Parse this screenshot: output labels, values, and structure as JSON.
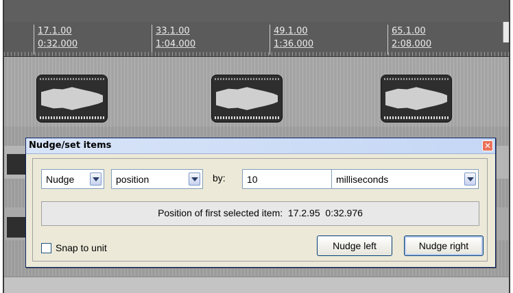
{
  "ruler": {
    "marks": [
      {
        "measure": "17.1.00",
        "time": "0:32.000"
      },
      {
        "measure": "33.1.00",
        "time": "1:04.000"
      },
      {
        "measure": "49.1.00",
        "time": "1:36.000"
      },
      {
        "measure": "65.1.00",
        "time": "2:08.000"
      }
    ]
  },
  "dialog": {
    "title": "Nudge/set items",
    "close_icon": "close-icon",
    "mode": {
      "selected": "Nudge"
    },
    "target": {
      "selected": "position"
    },
    "by_label": "by:",
    "amount": "10",
    "unit": {
      "selected": "milliseconds"
    },
    "info": {
      "label": "Position of first selected item:",
      "measure": "17.2.95",
      "time": "0:32.976"
    },
    "snap": {
      "label": "Snap to unit",
      "checked": false
    },
    "nudge_left_label": "Nudge left",
    "nudge_right_label": "Nudge right"
  },
  "colors": {
    "titlebar": "#c5d7f5",
    "close": "#e9725a",
    "dialog_bg": "#ece9d8",
    "arrange_bg": "#ababab"
  }
}
